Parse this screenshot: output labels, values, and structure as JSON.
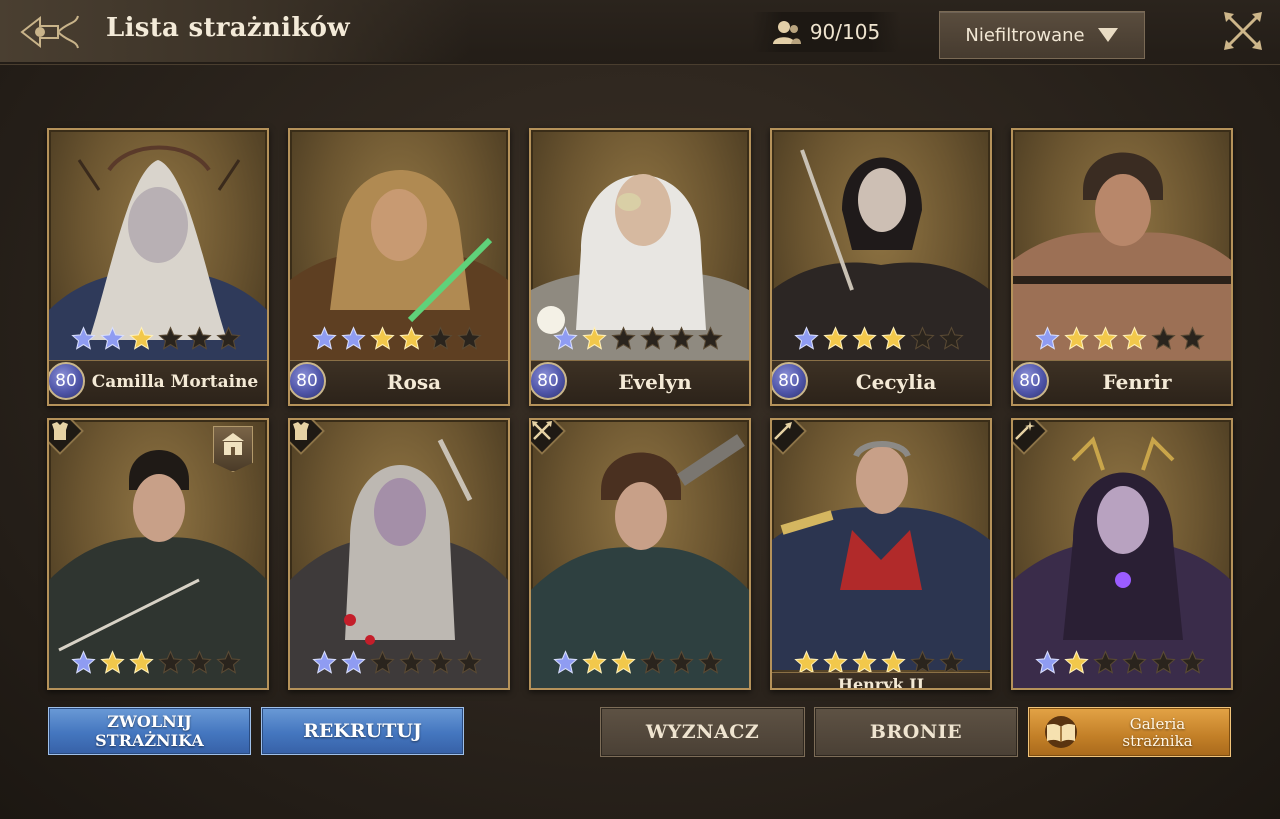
{
  "header": {
    "title": "Lista strażników",
    "guardian_count": "90/105",
    "filter_label": "Niefiltrowane"
  },
  "guardians": [
    {
      "name": "Camilla Mortaine",
      "level": "80",
      "stars": 3,
      "blue_stars": 2
    },
    {
      "name": "Rosa",
      "level": "80",
      "stars": 4,
      "blue_stars": 2
    },
    {
      "name": "Evelyn",
      "level": "80",
      "stars": 2,
      "blue_stars": 1
    },
    {
      "name": "Cecylia",
      "level": "80",
      "stars": 4,
      "blue_stars": 1
    },
    {
      "name": "Fenrir",
      "level": "80",
      "stars": 4,
      "blue_stars": 1
    },
    {
      "name": "",
      "stars": 3,
      "blue_stars": 1,
      "class_icon": "armor-icon",
      "has_building": true
    },
    {
      "name": "",
      "stars": 2,
      "blue_stars": 2,
      "class_icon": "armor-icon"
    },
    {
      "name": "",
      "stars": 3,
      "blue_stars": 1,
      "class_icon": "crossed-spears-icon"
    },
    {
      "name": "Henryk II",
      "stars": 4,
      "blue_stars": 0,
      "class_icon": "spear-icon"
    },
    {
      "name": "",
      "stars": 2,
      "blue_stars": 1,
      "class_icon": "magic-wand-icon"
    }
  ],
  "buttons": {
    "dismiss_line1": "ZWOLNIJ",
    "dismiss_line2": "STRAŻNIKA",
    "recruit": "REKRUTUJ",
    "assign": "WYZNACZ",
    "weapons": "BRONIE",
    "gallery_line1": "Galeria",
    "gallery_line2": "strażnika"
  },
  "colors": {
    "star_gold": "#f2c84b",
    "star_blue": "#8f9cf2",
    "star_empty": "#2a241d",
    "level_badge": "#5a60b8",
    "accent_gold": "#b5925a"
  }
}
